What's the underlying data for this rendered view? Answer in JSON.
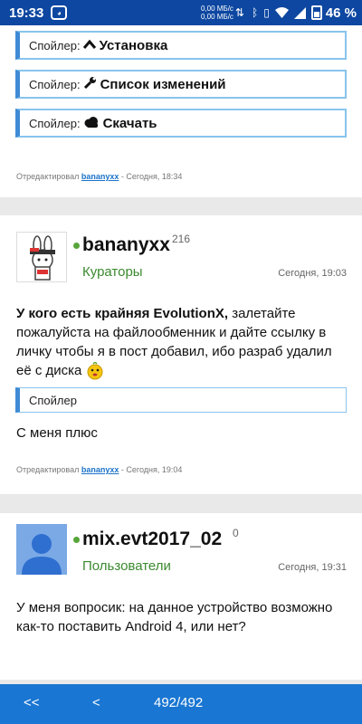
{
  "status_bar": {
    "time": "19:33",
    "speed_up": "0,00 МБ/с",
    "speed_down": "0,00 МБ/с",
    "battery": "46 %"
  },
  "post1": {
    "spoilers": [
      {
        "label": "Спойлер:",
        "icon": "chevron-up-icon",
        "title": "Установка"
      },
      {
        "label": "Спойлер:",
        "icon": "wrench-icon",
        "title": "Список изменений"
      },
      {
        "label": "Спойлер:",
        "icon": "cloud-icon",
        "title": "Скачать"
      }
    ],
    "edited_prefix": "Отредактировал",
    "edited_user": "bananyxx",
    "edited_suffix": "- Сегодня, 18:34"
  },
  "post2": {
    "username": "bananyxx",
    "count": "216",
    "group": "Кураторы",
    "date": "Сегодня, 19:03",
    "text_bold": "У кого есть крайняя EvolutionX,",
    "text_rest": " залетайте пожалуйста на файлообменник и дайте ссылку в личку чтобы я в пост добавил, ибо разраб удалил её с диска",
    "spoiler_label": "Спойлер",
    "text2": "С меня плюс",
    "edited_prefix": "Отредактировал",
    "edited_user": "bananyxx",
    "edited_suffix": "- Сегодня, 19:04"
  },
  "post3": {
    "username": "mix.evt2017_02",
    "count": "0",
    "group": "Пользователи",
    "date": "Сегодня, 19:31",
    "text": "У меня вопросик: на данное устройство возможно как-то поставить  Android 4, или нет?"
  },
  "pager": {
    "first": "<<",
    "prev": "<",
    "page": "492/492"
  },
  "colors": {
    "status_bar": "#0d47a1",
    "bottom_bar": "#1976d2",
    "spoiler_border": "#3f8ad6",
    "group_green": "#3a8a2e",
    "link_blue": "#1b73c9"
  }
}
